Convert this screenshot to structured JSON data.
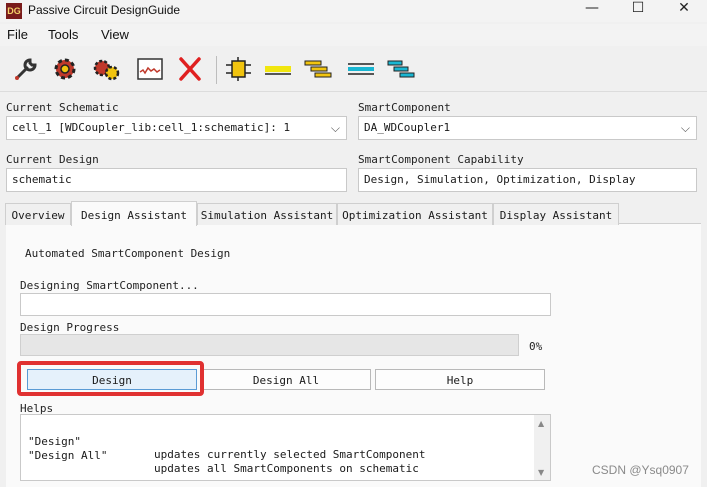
{
  "window": {
    "title": "Passive Circuit DesignGuide",
    "icon_label": "DG",
    "controls": {
      "minimize": "—",
      "maximize": "☐",
      "close": "✕"
    }
  },
  "menu": [
    {
      "label": "File"
    },
    {
      "label": "Tools"
    },
    {
      "label": "View"
    }
  ],
  "toolbar": [
    {
      "icon": "wrench-icon"
    },
    {
      "icon": "gear-icon"
    },
    {
      "icon": "gears-icon"
    },
    {
      "icon": "waveform-icon"
    },
    {
      "icon": "delete-x-icon"
    },
    {
      "icon": "component-icon"
    },
    {
      "icon": "microstrip-line-icon"
    },
    {
      "icon": "coupled-line-icon"
    },
    {
      "icon": "stripline-icon"
    },
    {
      "icon": "filter-icon"
    }
  ],
  "fields": {
    "current_schematic": {
      "label": "Current Schematic",
      "value": "cell_1 [WDCoupler_lib:cell_1:schematic]: 1"
    },
    "smart_component": {
      "label": "SmartComponent",
      "value": "DA_WDCoupler1"
    },
    "current_design": {
      "label": "Current Design",
      "value": "schematic"
    },
    "capability": {
      "label": "SmartComponent Capability",
      "value": "Design, Simulation, Optimization, Display"
    }
  },
  "tabs": [
    {
      "label": "Overview"
    },
    {
      "label": "Design Assistant",
      "active": true
    },
    {
      "label": "Simulation Assistant"
    },
    {
      "label": "Optimization Assistant"
    },
    {
      "label": "Display Assistant"
    }
  ],
  "design_panel": {
    "heading": "Automated SmartComponent Design",
    "designing_label": "Designing SmartComponent...",
    "designing_value": "",
    "progress_label": "Design Progress",
    "progress": 0,
    "progress_text": "0%",
    "buttons": {
      "design": "Design",
      "design_all": "Design All",
      "help": "Help"
    },
    "helps_label": "Helps",
    "helps": [
      {
        "key": "\"Design\"",
        "desc": "updates currently selected SmartComponent"
      },
      {
        "key": "\"Design All\"",
        "desc": "updates all SmartComponents on schematic"
      }
    ]
  },
  "watermark": "CSDN @Ysq0907",
  "colors": {
    "highlight": "#e03131",
    "focus": "#5a9bd5",
    "panel": "#fafafa"
  }
}
